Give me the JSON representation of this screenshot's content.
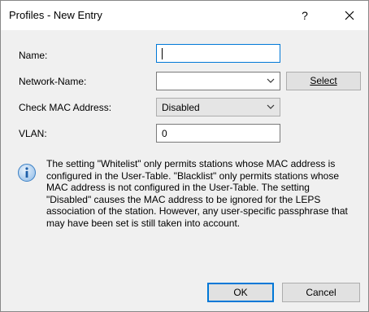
{
  "window": {
    "title": "Profiles - New Entry",
    "help_label": "?",
    "close_label": "X"
  },
  "form": {
    "name_label": "Name:",
    "name_value": "",
    "network_label": "Network-Name:",
    "network_value": "",
    "select_button": "Select",
    "mac_label": "Check MAC Address:",
    "mac_value": "Disabled",
    "vlan_label": "VLAN:",
    "vlan_value": "0"
  },
  "info": {
    "icon": "info-icon",
    "text": "The setting \"Whitelist\" only permits stations whose MAC address is configured in the User-Table. \"Blacklist\" only permits stations whose MAC address is not configured in the User-Table. The setting \"Disabled\" causes the MAC address to be ignored for the LEPS association of the station. However, any user-specific passphrase that may have been set is still taken into account."
  },
  "footer": {
    "ok_label": "OK",
    "cancel_label": "Cancel"
  },
  "colors": {
    "focus_border": "#0078d7",
    "info_icon": "#3a7fc4"
  }
}
